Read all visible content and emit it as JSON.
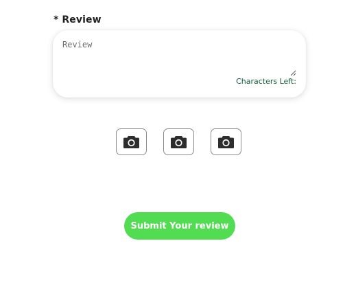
{
  "review": {
    "label": "* Review",
    "placeholder": "Review",
    "value": "",
    "characters_left_label": "Characters Left:"
  },
  "photo_uploads": [
    {
      "icon": "camera-icon"
    },
    {
      "icon": "camera-icon"
    },
    {
      "icon": "camera-icon"
    }
  ],
  "submit": {
    "label": "Submit Your review"
  },
  "colors": {
    "accent_green": "#52dc52",
    "counter_text": "#0f5a38"
  }
}
